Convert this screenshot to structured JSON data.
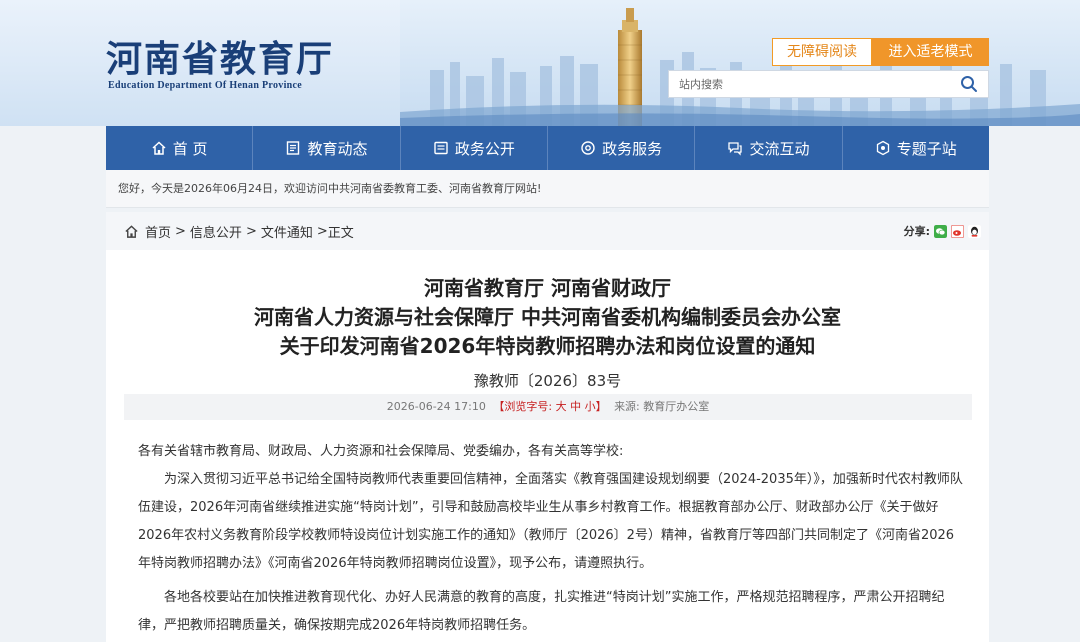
{
  "header": {
    "logo_cn": "河南省教育厅",
    "logo_en": "Education Department Of Henan Province",
    "accessibility_label": "无障碍阅读",
    "elder_mode_label": "进入适老模式",
    "search_placeholder": "站内搜索"
  },
  "nav": {
    "items": [
      {
        "label": "首 页",
        "icon": "home-icon"
      },
      {
        "label": "教育动态",
        "icon": "news-icon"
      },
      {
        "label": "政务公开",
        "icon": "document-icon"
      },
      {
        "label": "政务服务",
        "icon": "service-icon"
      },
      {
        "label": "交流互动",
        "icon": "interact-icon"
      },
      {
        "label": "专题子站",
        "icon": "topic-icon"
      }
    ]
  },
  "welcome_text": "您好，今天是2026年06月24日，欢迎访问中共河南省委教育工委、河南省教育厅网站!",
  "breadcrumb": {
    "home": "首页",
    "items": [
      "信息公开",
      "文件通知"
    ],
    "current": "正文",
    "sep": ">"
  },
  "share": {
    "label": "分享:",
    "icons": [
      "wechat-icon",
      "weibo-icon",
      "qq-icon"
    ],
    "colors": {
      "wechat": "#3fae49",
      "weibo": "#e0352b",
      "qq": "#3a8ee6"
    }
  },
  "article": {
    "title_lines": [
      "河南省教育厅 河南省财政厅",
      "河南省人力资源与社会保障厅 中共河南省委机构编制委员会办公室",
      "关于印发河南省2026年特岗教师招聘办法和岗位设置的通知"
    ],
    "doc_no": "豫教师〔2026〕83号",
    "meta": {
      "datetime": "2026-06-24 17:10",
      "font_size_label": "【浏览字号: ",
      "font_sizes": [
        "大",
        "中",
        "小"
      ],
      "font_size_close": "】",
      "source": "来源: 教育厅办公室"
    },
    "paragraphs": [
      "各有关省辖市教育局、财政局、人力资源和社会保障局、党委编办，各有关高等学校:",
      "为深入贯彻习近平总书记给全国特岗教师代表重要回信精神，全面落实《教育强国建设规划纲要（2024-2035年）》，加强新时代农村教师队伍建设，2026年河南省继续推进实施“特岗计划”，引导和鼓励高校毕业生从事乡村教育工作。根据教育部办公厅、财政部办公厅《关于做好2026年农村义务教育阶段学校教师特设岗位计划实施工作的通知》（教师厅〔2026〕2号）精神，省教育厅等四部门共同制定了《河南省2026年特岗教师招聘办法》《河南省2026年特岗教师招聘岗位设置》，现予公布，请遵照执行。",
      "各地各校要站在加快推进教育现代化、办好人民满意的教育的高度，扎实推进“特岗计划”实施工作，严格规范招聘程序，严肃公开招聘纪律，严把教师招聘质量关，确保按期完成2026年特岗教师招聘任务。"
    ]
  },
  "colors": {
    "nav_bg": "#2f62a8",
    "brand_text": "#1a3f78",
    "accent_orange": "#f0962a",
    "meta_red": "#c62020"
  }
}
